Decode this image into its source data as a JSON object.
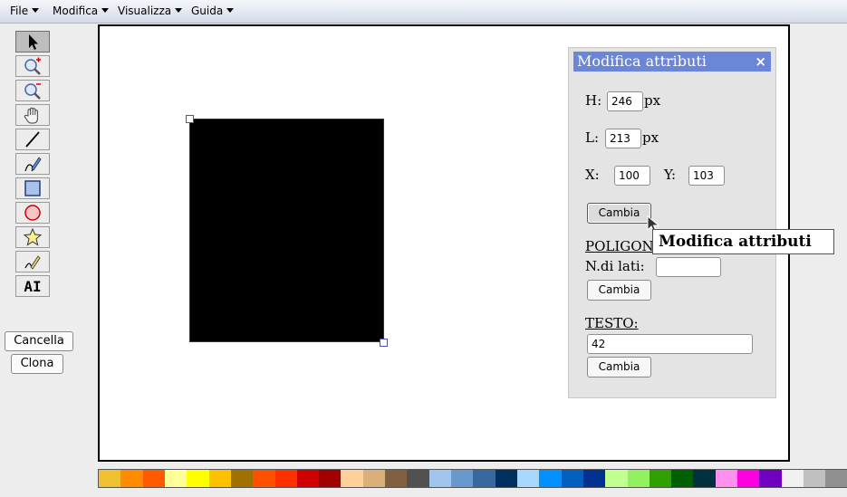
{
  "menu": [
    {
      "label": "File",
      "icon": "dropdown-arrow"
    },
    {
      "label": "Modifica",
      "icon": "dropdown-arrow"
    },
    {
      "label": "Visualizza",
      "icon": "dropdown-arrow"
    },
    {
      "label": "Guida",
      "icon": "dropdown-arrow"
    }
  ],
  "tools": [
    {
      "name": "select-tool",
      "icon": "pointer-arrow-icon",
      "active": true
    },
    {
      "name": "zoom-in-tool",
      "icon": "zoom-in-icon"
    },
    {
      "name": "zoom-out-tool",
      "icon": "zoom-out-icon"
    },
    {
      "name": "pan-tool",
      "icon": "hand-icon"
    },
    {
      "name": "line-tool",
      "icon": "line-icon"
    },
    {
      "name": "pen-tool",
      "icon": "pen-icon"
    },
    {
      "name": "rectangle-tool",
      "icon": "square-icon"
    },
    {
      "name": "ellipse-tool",
      "icon": "circle-icon"
    },
    {
      "name": "polygon-tool",
      "icon": "star-icon"
    },
    {
      "name": "freehand-tool",
      "icon": "pencil-icon"
    },
    {
      "name": "text-tool",
      "icon": "text-icon",
      "label": "AI"
    }
  ],
  "side_buttons": {
    "delete": "Cancella",
    "clone": "Clona"
  },
  "panel": {
    "title": "Modifica attributi",
    "close": "×",
    "height_label": "H:",
    "height_value": "246",
    "width_label": "L:",
    "width_value": "213",
    "unit": "px",
    "x_label": "X:",
    "x_value": "100",
    "y_label": "Y:",
    "y_value": "103",
    "apply_label": "Cambia",
    "polygon_heading": "POLIGONO:",
    "sides_label": "N.di lati:",
    "sides_value": "",
    "text_heading": "TESTO:",
    "text_value": "42"
  },
  "tooltip": "Modifica attributi",
  "colors": {
    "menubar": "#d4dbe7",
    "panel_header": "#6c86d7",
    "selection_handle": "#4a4ad8",
    "shape_fill": "#000000"
  },
  "palette": [
    "#f0c030",
    "#ff8c00",
    "#ff5a00",
    "#ffff99",
    "#ffff00",
    "#ffc000",
    "#a07000",
    "#ff5000",
    "#ff3000",
    "#d00000",
    "#a00000",
    "#ffd09a",
    "#d9b07a",
    "#806040",
    "#505050",
    "#a0c4ec",
    "#6898cc",
    "#3868a0",
    "#003060",
    "#a8d8ff",
    "#0090ff",
    "#0060c0",
    "#003090",
    "#c0ff90",
    "#90f060",
    "#30a000",
    "#006000",
    "#003040",
    "#ff90f0",
    "#ff00e0",
    "#7000c0",
    "#f0f0f0",
    "#c0c0c0",
    "#909090"
  ]
}
